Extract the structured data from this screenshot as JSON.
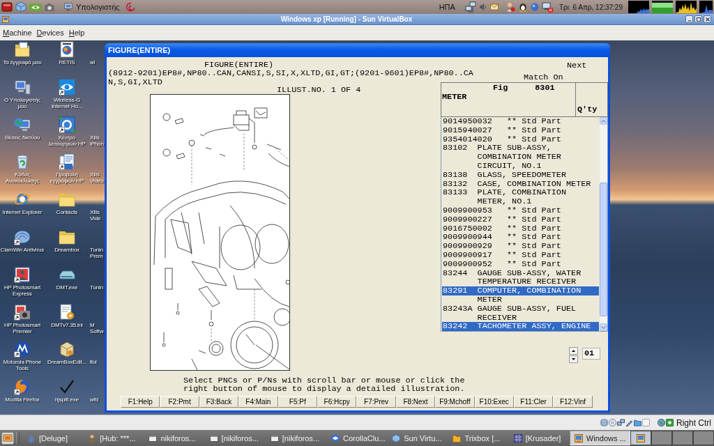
{
  "top_panel": {
    "places_label": "Υπολογιστής",
    "keyboard_layout": "ΗΠΑ",
    "clock": "Τρι  6 Απρ, 12:37:29"
  },
  "vbox": {
    "title": "Windows xp [Running] - Sun VirtualBox",
    "menu": [
      "Machine",
      "Devices",
      "Help"
    ]
  },
  "desktop": {
    "rows": [
      {
        "icons": [
          {
            "label": "Τα έγγραφά μου",
            "shortcut": false
          },
          {
            "label": "RETIS",
            "shortcut": false
          }
        ],
        "partial_label": "wi"
      },
      {
        "icons": [
          {
            "label": "Ο Υπολογιστής μου",
            "shortcut": false
          },
          {
            "label": "Wireless-G Internet Ho...",
            "shortcut": true
          }
        ]
      },
      {
        "icons": [
          {
            "label": "Θέσεις δικτύου",
            "shortcut": false
          },
          {
            "label": "Κέντρο λειτουργιών HP",
            "shortcut": true
          }
        ],
        "partial_label": "Xilis iPhon"
      },
      {
        "icons": [
          {
            "label": "Κάδος Ανακύκλωσης",
            "shortcut": false
          },
          {
            "label": "Προβολή εγγράφων HP",
            "shortcut": true
          }
        ],
        "partial_label": "Xilis Video"
      },
      {
        "icons": [
          {
            "label": "Internet Explorer",
            "shortcut": false
          },
          {
            "label": "Contacts",
            "shortcut": false
          }
        ],
        "partial_label": "Xilis Vide"
      },
      {
        "icons": [
          {
            "label": "ClamWin Antivirus",
            "shortcut": true
          },
          {
            "label": "Dreambox",
            "shortcut": false
          }
        ],
        "partial_label": "Tunin Prem"
      },
      {
        "icons": [
          {
            "label": "HP Photosmart Express",
            "shortcut": true
          },
          {
            "label": "DMT.exe",
            "shortcut": false
          }
        ],
        "partial_label": "Tunin"
      },
      {
        "icons": [
          {
            "label": "HP Photosmart Premier",
            "shortcut": true
          },
          {
            "label": "DMTv7.35.ini",
            "shortcut": false
          }
        ],
        "partial_label": "M Softw"
      },
      {
        "icons": [
          {
            "label": "Motorola Phone Tools",
            "shortcut": true
          },
          {
            "label": "DreamBoxEdit...",
            "shortcut": false
          }
        ],
        "partial_label": "floi"
      },
      {
        "icons": [
          {
            "label": "Mozilla Firefox",
            "shortcut": true
          },
          {
            "label": "hjsplit.exe",
            "shortcut": false
          }
        ],
        "partial_label": "wfd"
      }
    ]
  },
  "dialog": {
    "title": "FIGURE(ENTIRE)",
    "heading": "FIGURE(ENTIRE)",
    "next_label": "Next",
    "match_label": "Match On",
    "applicability": "(8912-9201)EP8#,NP80..CAN,CANSI,S,SI,X,XLTD,GI,GT;(9201-9601)EP8#,NP80..CAN,S,GI,XLTD",
    "illust_no": "ILLUST.NO. 1 OF 4",
    "list_header": {
      "fig_label": "Fig",
      "fig_number": "8301",
      "group": "METER",
      "qty_label": "Q'ty"
    },
    "parts": [
      {
        "kind": "std",
        "number": "9014950032",
        "description": "** Std Part",
        "selected": false
      },
      {
        "kind": "std",
        "number": "9015940027",
        "description": "** Std Part",
        "selected": false
      },
      {
        "kind": "std",
        "number": "9354014020",
        "description": "** Std Part",
        "selected": false
      },
      {
        "kind": "pnc",
        "number": "83102",
        "description": "PLATE SUB-ASSY,",
        "selected": false
      },
      {
        "kind": "continuation",
        "description": "COMBINATION METER",
        "selected": false
      },
      {
        "kind": "continuation",
        "description": "CIRCUIT, NO.1",
        "selected": false
      },
      {
        "kind": "pnc",
        "number": "83138",
        "description": "GLASS, SPEEDOMETER",
        "selected": false
      },
      {
        "kind": "pnc",
        "number": "83132",
        "description": "CASE, COMBINATION METER",
        "selected": false
      },
      {
        "kind": "pnc",
        "number": "83133",
        "description": "PLATE, COMBINATION",
        "selected": false
      },
      {
        "kind": "continuation",
        "description": "METER, NO.1",
        "selected": false
      },
      {
        "kind": "std",
        "number": "9009900953",
        "description": "** Std Part",
        "selected": false
      },
      {
        "kind": "std",
        "number": "9009900227",
        "description": "** Std Part",
        "selected": false
      },
      {
        "kind": "std",
        "number": "9016750002",
        "description": "** Std Part",
        "selected": false
      },
      {
        "kind": "std",
        "number": "9009900944",
        "description": "** Std Part",
        "selected": false
      },
      {
        "kind": "std",
        "number": "9009900929",
        "description": "** Std Part",
        "selected": false
      },
      {
        "kind": "std",
        "number": "9009900917",
        "description": "** Std Part",
        "selected": false
      },
      {
        "kind": "std",
        "number": "9009900952",
        "description": "** Std Part",
        "selected": false
      },
      {
        "kind": "pnc",
        "number": "83244",
        "description": "GAUGE SUB-ASSY, WATER",
        "selected": false
      },
      {
        "kind": "continuation",
        "description": "TEMPERATURE RECEIVER",
        "selected": false
      },
      {
        "kind": "pnc",
        "number": "83291",
        "description": "COMPUTER, COMBINATION",
        "selected": true
      },
      {
        "kind": "continuation",
        "description": "METER",
        "selected": false
      },
      {
        "kind": "pnc",
        "number": "83243A",
        "description": "GAUGE SUB-ASSY, FUEL",
        "selected": false
      },
      {
        "kind": "continuation",
        "description": "RECEIVER",
        "selected": false
      },
      {
        "kind": "pnc",
        "number": "83242",
        "description": "TACHOMETER ASSY, ENGINE",
        "selected": true
      }
    ],
    "page": "01",
    "hint": "Select PNCs or P/Ns with scroll bar or mouse or click the right button of mouse to display a detailed illustration.",
    "function_keys": [
      "F1:Help",
      "F2:Pmt",
      "F3:Back",
      "F4:Main",
      "F5:Pf",
      "F6:Hcpy",
      "F7:Prev",
      "F8:Next",
      "F9:Mchoff",
      "F10:Exec",
      "F11:Cler",
      "F12:Vinf"
    ]
  },
  "status_bar": {
    "host_key": "Right Ctrl"
  },
  "taskbar": {
    "items": [
      {
        "label": "[Deluge]",
        "selected": false
      },
      {
        "label": "[Hub: ***...",
        "selected": false
      },
      {
        "label": "nikiforos...",
        "selected": false
      },
      {
        "label": "[nikiforos...",
        "selected": false
      },
      {
        "label": "[nikiforos...",
        "selected": false
      },
      {
        "label": "CorollaClu...",
        "selected": false
      },
      {
        "label": "Sun Virtu...",
        "selected": false
      },
      {
        "label": "Trixbox [...",
        "selected": false
      },
      {
        "label": "[Krusader]",
        "selected": false
      },
      {
        "label": "Windows ...",
        "selected": true
      }
    ],
    "workspaces": [
      {
        "selected": true
      },
      {
        "selected": false
      },
      {
        "selected": false
      },
      {
        "selected": false
      }
    ]
  }
}
